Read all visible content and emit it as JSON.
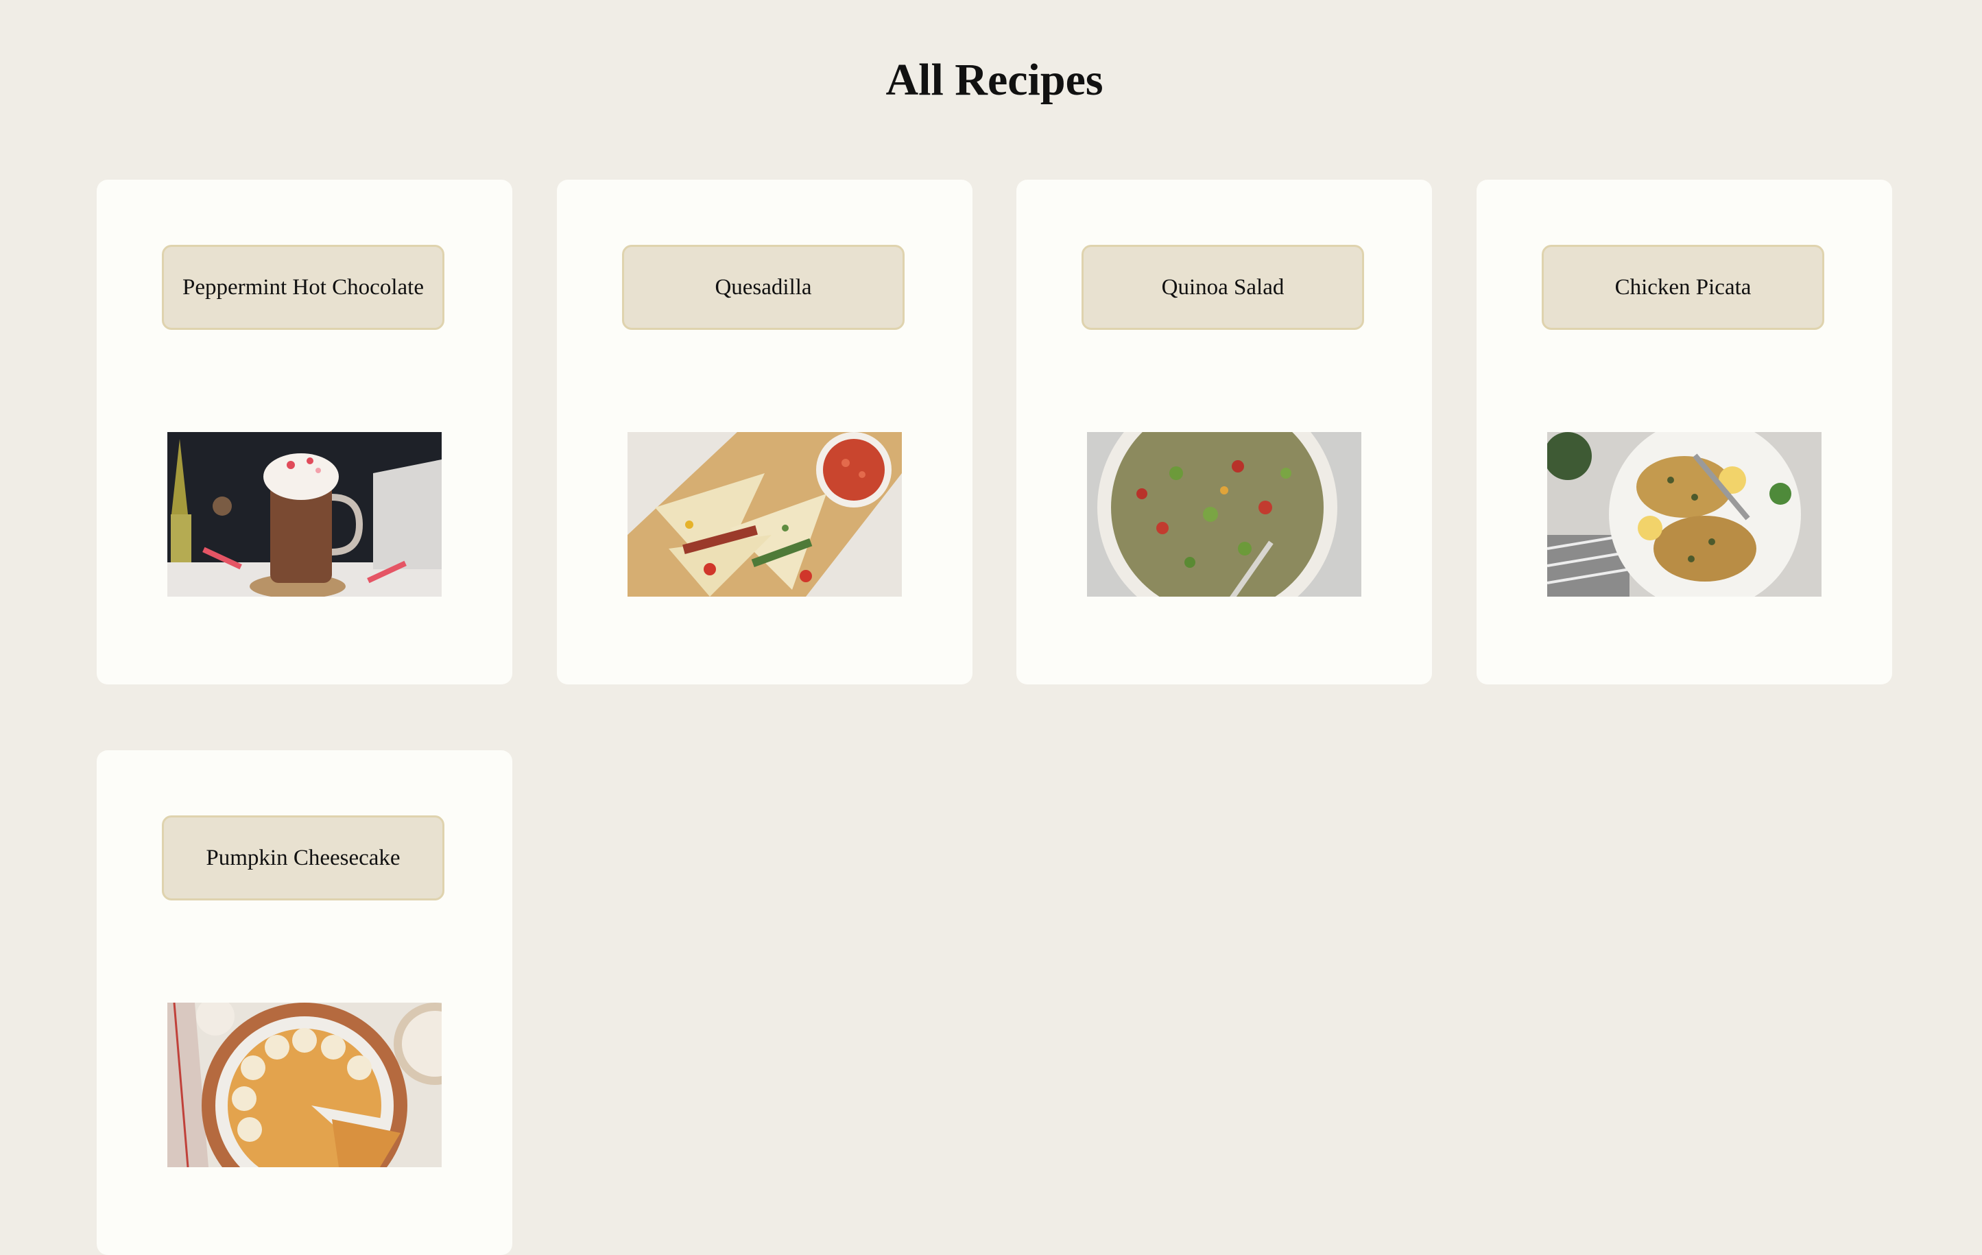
{
  "page": {
    "title": "All Recipes"
  },
  "recipes": [
    {
      "name": "Peppermint Hot Chocolate",
      "image": "hot-chocolate-photo"
    },
    {
      "name": "Quesadilla",
      "image": "quesadilla-photo"
    },
    {
      "name": "Quinoa Salad",
      "image": "quinoa-salad-photo"
    },
    {
      "name": "Chicken Picata",
      "image": "chicken-picata-photo"
    },
    {
      "name": "Pumpkin Cheesecake",
      "image": "pumpkin-cheesecake-photo"
    }
  ],
  "colors": {
    "background": "#f0ede6",
    "card": "#fdfdf9",
    "button_fill": "#e8e1d0",
    "button_border": "#dfd3ae"
  }
}
